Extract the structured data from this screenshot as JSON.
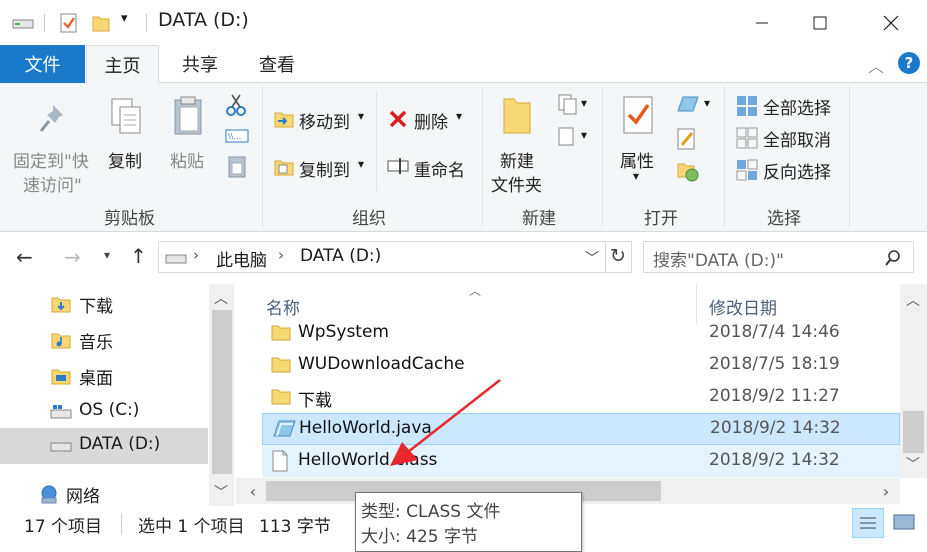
{
  "window": {
    "title": "DATA (D:)"
  },
  "ribbon_tabs": [
    {
      "label": "文件"
    },
    {
      "label": "主页"
    },
    {
      "label": "共享"
    },
    {
      "label": "查看"
    }
  ],
  "ribbon": {
    "clipboard": {
      "pin_line1": "固定到\"快",
      "pin_line2": "速访问\"",
      "copy": "复制",
      "paste": "粘贴",
      "group": "剪贴板"
    },
    "organize": {
      "move_to": "移动到",
      "copy_to": "复制到",
      "delete": "删除",
      "rename": "重命名",
      "group": "组织"
    },
    "new": {
      "folder_line1": "新建",
      "folder_line2": "文件夹",
      "group": "新建"
    },
    "open": {
      "properties": "属性",
      "group": "打开"
    },
    "select": {
      "select_all": "全部选择",
      "select_none": "全部取消",
      "invert": "反向选择",
      "group": "选择"
    }
  },
  "address": {
    "crumb1": "此电脑",
    "crumb2": "DATA (D:)",
    "search_placeholder": "搜索\"DATA (D:)\""
  },
  "nav": [
    {
      "label": "下载"
    },
    {
      "label": "音乐"
    },
    {
      "label": "桌面"
    },
    {
      "label": "OS (C:)"
    },
    {
      "label": "DATA (D:)"
    },
    {
      "label": "网络"
    }
  ],
  "columns": {
    "name": "名称",
    "date": "修改日期"
  },
  "files": [
    {
      "name": "WpSystem",
      "date": "2018/7/4 14:46",
      "type": "folder"
    },
    {
      "name": "WUDownloadCache",
      "date": "2018/7/5 18:19",
      "type": "folder"
    },
    {
      "name": "下载",
      "date": "2018/9/2 11:27",
      "type": "folder-download"
    },
    {
      "name": "HelloWorld.java",
      "date": "2018/9/2 14:32",
      "type": "java"
    },
    {
      "name": "HelloWorld.class",
      "date": "2018/9/2 14:32",
      "type": "class"
    }
  ],
  "status": {
    "count": "17 个项目",
    "selected": "选中 1 个项目",
    "size": "113 字节"
  },
  "tooltip": {
    "type": "类型: CLASS 文件",
    "size": "大小: 425 字节"
  },
  "colors": {
    "accent": "#1979ca",
    "selected_row": "#cce8ff",
    "hover_row": "#e5f3ff",
    "folder": "#f8d775",
    "arrow": "#e8282b"
  }
}
